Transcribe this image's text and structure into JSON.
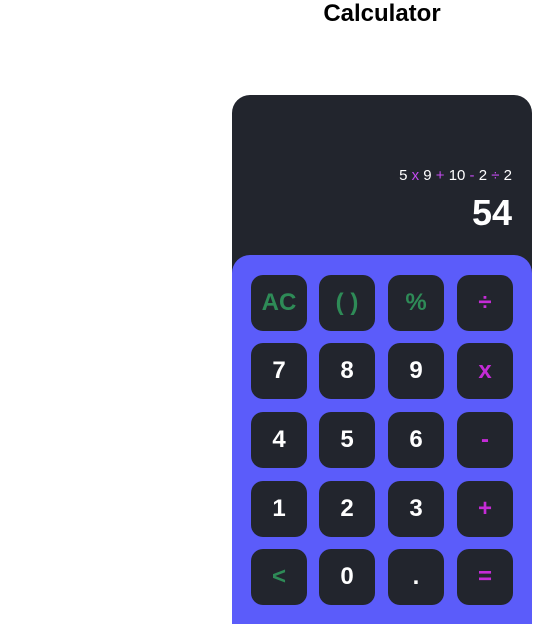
{
  "page": {
    "title": "Calculator"
  },
  "display": {
    "expression": [
      {
        "text": "5",
        "kind": "num"
      },
      {
        "text": " x ",
        "kind": "op"
      },
      {
        "text": "9",
        "kind": "num"
      },
      {
        "text": " + ",
        "kind": "op"
      },
      {
        "text": "10",
        "kind": "num"
      },
      {
        "text": " - ",
        "kind": "op"
      },
      {
        "text": "2",
        "kind": "num"
      },
      {
        "text": " ÷ ",
        "kind": "op"
      },
      {
        "text": "2",
        "kind": "num"
      }
    ],
    "result": "54"
  },
  "keypad": {
    "rows": [
      [
        {
          "label": "AC",
          "kind": "fn",
          "name": "clear-button"
        },
        {
          "label": "( )",
          "kind": "fn",
          "name": "parentheses-button"
        },
        {
          "label": "%",
          "kind": "fn",
          "name": "percent-button"
        },
        {
          "label": "÷",
          "kind": "op",
          "name": "divide-button"
        }
      ],
      [
        {
          "label": "7",
          "kind": "num",
          "name": "digit-7-button"
        },
        {
          "label": "8",
          "kind": "num",
          "name": "digit-8-button"
        },
        {
          "label": "9",
          "kind": "num",
          "name": "digit-9-button"
        },
        {
          "label": "x",
          "kind": "op",
          "name": "multiply-button"
        }
      ],
      [
        {
          "label": "4",
          "kind": "num",
          "name": "digit-4-button"
        },
        {
          "label": "5",
          "kind": "num",
          "name": "digit-5-button"
        },
        {
          "label": "6",
          "kind": "num",
          "name": "digit-6-button"
        },
        {
          "label": "-",
          "kind": "op",
          "name": "subtract-button"
        }
      ],
      [
        {
          "label": "1",
          "kind": "num",
          "name": "digit-1-button"
        },
        {
          "label": "2",
          "kind": "num",
          "name": "digit-2-button"
        },
        {
          "label": "3",
          "kind": "num",
          "name": "digit-3-button"
        },
        {
          "label": "+",
          "kind": "op",
          "name": "add-button"
        }
      ],
      [
        {
          "label": "<",
          "kind": "fn",
          "name": "backspace-button"
        },
        {
          "label": "0",
          "kind": "num",
          "name": "digit-0-button"
        },
        {
          "label": ".",
          "kind": "num",
          "name": "decimal-button"
        },
        {
          "label": "=",
          "kind": "op",
          "name": "equals-button"
        }
      ]
    ]
  },
  "colors": {
    "body_bg": "#22252d",
    "keypad_bg": "#5b5cfa",
    "key_bg": "#22252d",
    "digit": "#ffffff",
    "function": "#2e8b57",
    "operator": "#c42bd6"
  }
}
